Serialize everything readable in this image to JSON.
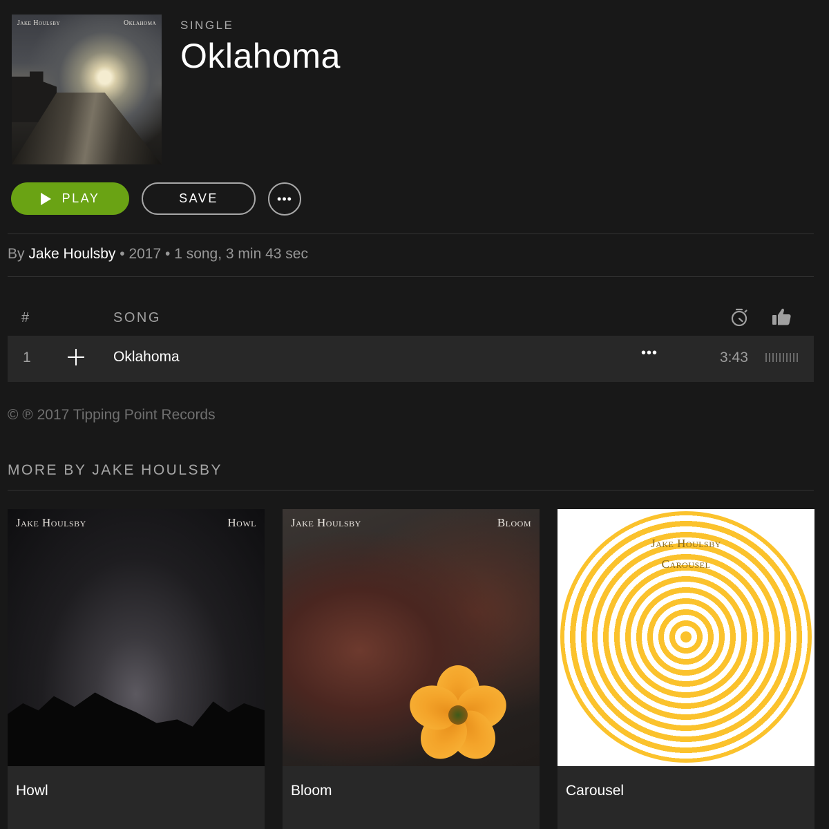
{
  "album": {
    "cover_artist_text": "Jake Houlsby",
    "cover_title_text": "Oklahoma",
    "type": "SINGLE",
    "title": "Oklahoma"
  },
  "actions": {
    "play_label": "PLAY",
    "save_label": "SAVE",
    "more_label": "•••"
  },
  "meta": {
    "by_prefix": "By",
    "artist": "Jake Houlsby",
    "details": "• 2017 • 1 song, 3 min 43 sec"
  },
  "tracklist": {
    "headers": {
      "number": "#",
      "song": "SONG",
      "duration_icon": "stopwatch-icon",
      "popularity_icon": "thumbs-up-icon"
    },
    "tracks": [
      {
        "number": "1",
        "title": "Oklahoma",
        "more_label": "•••",
        "duration": "3:43",
        "add_icon": "plus-icon"
      }
    ]
  },
  "copyright": "© ℗ 2017 Tipping Point Records",
  "more_by": {
    "heading": "MORE BY JAKE HOULSBY",
    "albums": [
      {
        "name": "Howl",
        "art_artist": "Jake Houlsby",
        "art_title": "Howl"
      },
      {
        "name": "Bloom",
        "art_artist": "Jake Houlsby",
        "art_title": "Bloom"
      },
      {
        "name": "Carousel",
        "art_artist": "Jake Houlsby",
        "art_title": "Carousel"
      }
    ]
  },
  "colors": {
    "background": "#181818",
    "row_highlight": "#282828",
    "accent_green": "#6aa314",
    "text_primary": "#ffffff",
    "text_secondary": "#b3b3b3"
  }
}
